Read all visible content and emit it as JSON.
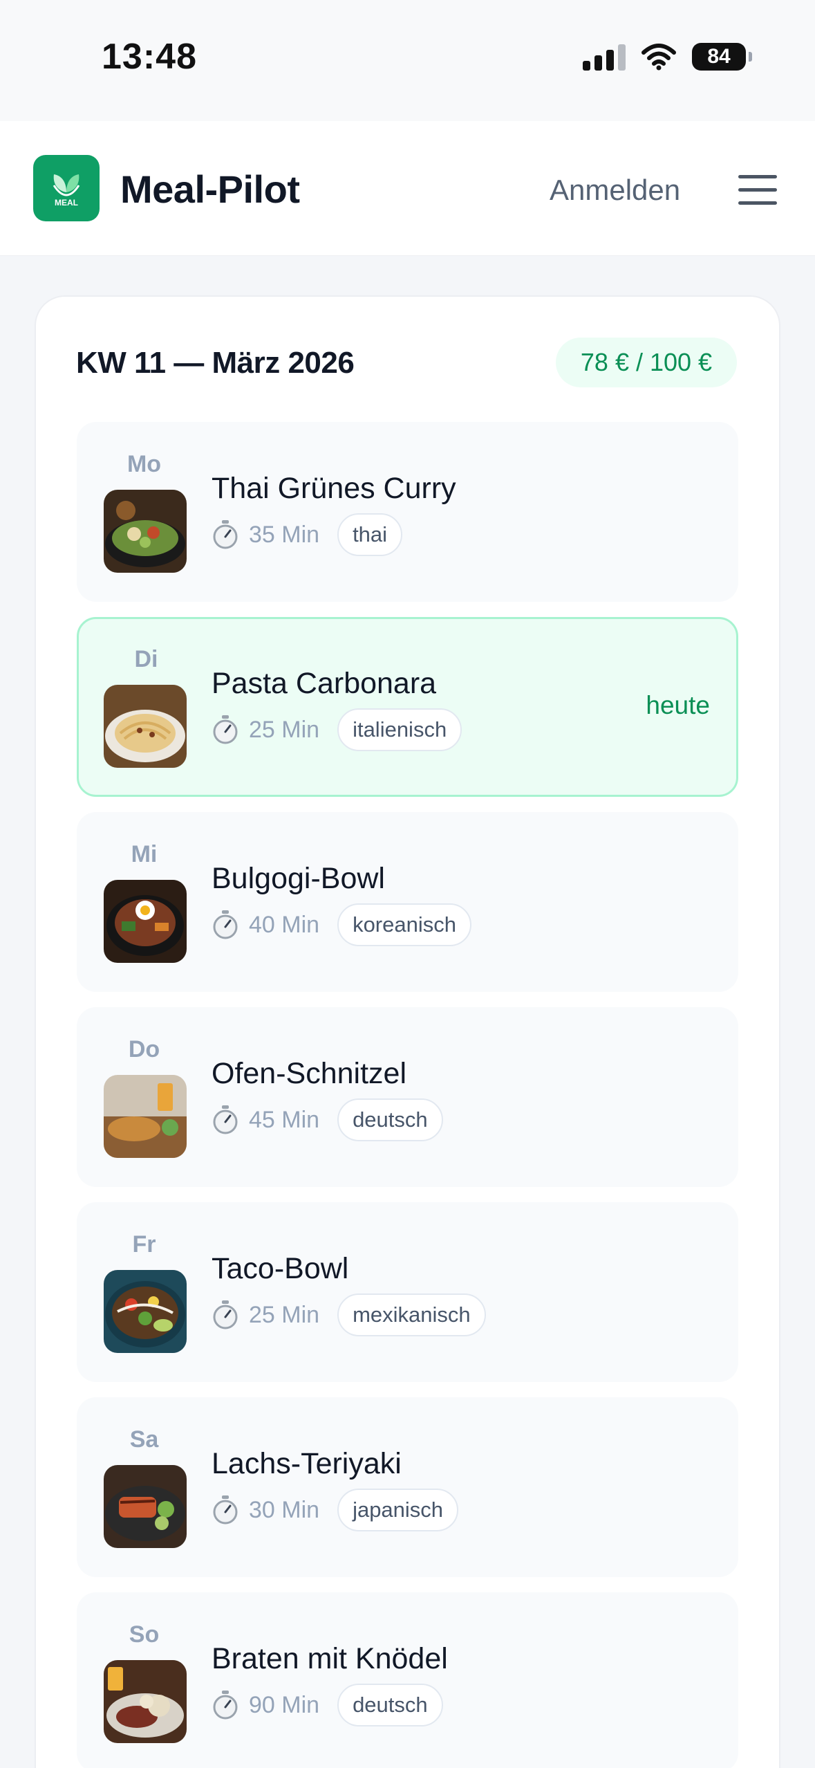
{
  "status_bar": {
    "time": "13:48",
    "battery": "84"
  },
  "header": {
    "app_title": "Meal-Pilot",
    "logo_text": "MEAL",
    "login_label": "Anmelden"
  },
  "plan": {
    "week_title": "KW 11 — März 2026",
    "budget": "78 € / 100 €",
    "days": [
      {
        "day": "Mo",
        "name": "Thai Grünes Curry",
        "minutes": "35 Min",
        "tag": "thai",
        "today": false
      },
      {
        "day": "Di",
        "name": "Pasta Carbonara",
        "minutes": "25 Min",
        "tag": "italienisch",
        "today": true,
        "today_label": "heute"
      },
      {
        "day": "Mi",
        "name": "Bulgogi-Bowl",
        "minutes": "40 Min",
        "tag": "koreanisch",
        "today": false
      },
      {
        "day": "Do",
        "name": "Ofen-Schnitzel",
        "minutes": "45 Min",
        "tag": "deutsch",
        "today": false
      },
      {
        "day": "Fr",
        "name": "Taco-Bowl",
        "minutes": "25 Min",
        "tag": "mexikanisch",
        "today": false
      },
      {
        "day": "Sa",
        "name": "Lachs-Teriyaki",
        "minutes": "30 Min",
        "tag": "japanisch",
        "today": false
      },
      {
        "day": "So",
        "name": "Braten mit Knödel",
        "minutes": "90 Min",
        "tag": "deutsch",
        "today": false
      }
    ]
  },
  "colors": {
    "brand_green": "#0f9f65",
    "today_bg": "#ecfdf5",
    "today_border": "#a7f3d0",
    "accent_text": "#0a8f55"
  }
}
